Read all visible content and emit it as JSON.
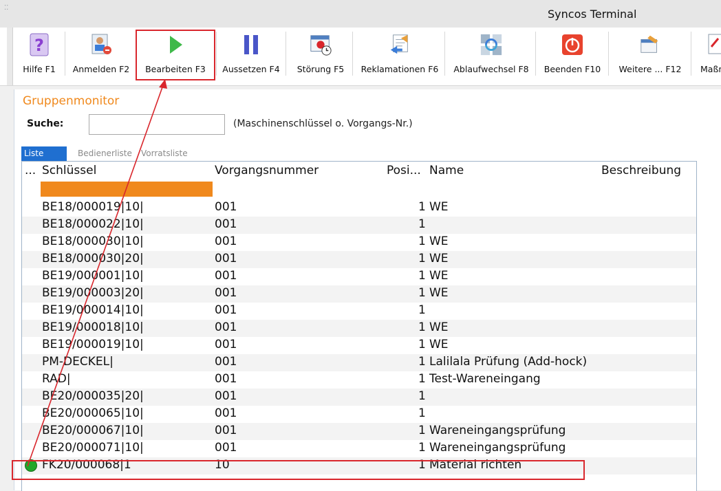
{
  "window": {
    "title": "Syncos Terminal",
    "system_icon": "app-menu-icon"
  },
  "toolbar": {
    "buttons": [
      {
        "label": "Hilfe F1",
        "icon": "help-icon"
      },
      {
        "label": "Anmelden F2",
        "icon": "login-icon"
      },
      {
        "label": "Bearbeiten F3",
        "icon": "play-icon"
      },
      {
        "label": "Aussetzen F4",
        "icon": "pause-icon"
      },
      {
        "label": "Störung F5",
        "icon": "calendar-alert-icon"
      },
      {
        "label": "Reklamationen F6",
        "icon": "complaint-icon"
      },
      {
        "label": "Ablaufwechsel F8",
        "icon": "switch-flow-icon"
      },
      {
        "label": "Beenden F10",
        "icon": "power-icon"
      },
      {
        "label": "Weitere ... F12",
        "icon": "more-icon"
      },
      {
        "label": "Maßn",
        "icon": "measures-icon"
      }
    ]
  },
  "panel": {
    "title": "Gruppenmonitor",
    "search": {
      "label": "Suche:",
      "value": "",
      "hint": "(Maschinenschlüssel o. Vorgangs-Nr.)"
    },
    "tabs": [
      {
        "label": "Liste",
        "active": true
      },
      {
        "label": "Bedienerliste",
        "active": false
      },
      {
        "label": "Vorratsliste",
        "active": false
      }
    ]
  },
  "table": {
    "columns": [
      "...",
      "Schlüssel",
      "Vorgangsnummer",
      "Posi...",
      "Name",
      "Beschreibung"
    ],
    "filter_color": "#f0891d",
    "rows": [
      {
        "key": "BE18/000019|10|",
        "vorgang": "001",
        "pos": "1",
        "name": "WE"
      },
      {
        "key": "BE18/000022|10|",
        "vorgang": "001",
        "pos": "1",
        "name": ""
      },
      {
        "key": "BE18/000030|10|",
        "vorgang": "001",
        "pos": "1",
        "name": "WE"
      },
      {
        "key": "BE18/000030|20|",
        "vorgang": "001",
        "pos": "1",
        "name": "WE"
      },
      {
        "key": "BE19/000001|10|",
        "vorgang": "001",
        "pos": "1",
        "name": "WE"
      },
      {
        "key": "BE19/000003|20|",
        "vorgang": "001",
        "pos": "1",
        "name": "WE"
      },
      {
        "key": "BE19/000014|10|",
        "vorgang": "001",
        "pos": "1",
        "name": ""
      },
      {
        "key": "BE19/000018|10|",
        "vorgang": "001",
        "pos": "1",
        "name": "WE"
      },
      {
        "key": "BE19/000019|10|",
        "vorgang": "001",
        "pos": "1",
        "name": "WE"
      },
      {
        "key": "PM-DECKEL|",
        "vorgang": "001",
        "pos": "1",
        "name": "Lalilala Prüfung (Add-hock)"
      },
      {
        "key": "RAD|",
        "vorgang": "001",
        "pos": "1",
        "name": "Test-Wareneingang"
      },
      {
        "key": "BE20/000035|20|",
        "vorgang": "001",
        "pos": "1",
        "name": ""
      },
      {
        "key": "BE20/000065|10|",
        "vorgang": "001",
        "pos": "1",
        "name": ""
      },
      {
        "key": "BE20/000067|10|",
        "vorgang": "001",
        "pos": "1",
        "name": "Wareneingangsprüfung"
      },
      {
        "key": "BE20/000071|10|",
        "vorgang": "001",
        "pos": "1",
        "name": "Wareneingangsprüfung"
      },
      {
        "key": "FK20/000068|1",
        "vorgang": "10",
        "pos": "1",
        "name": "Material richten",
        "status": "active",
        "status_color": "#22a72a"
      }
    ]
  },
  "annotation": {
    "color": "#d9262c"
  }
}
